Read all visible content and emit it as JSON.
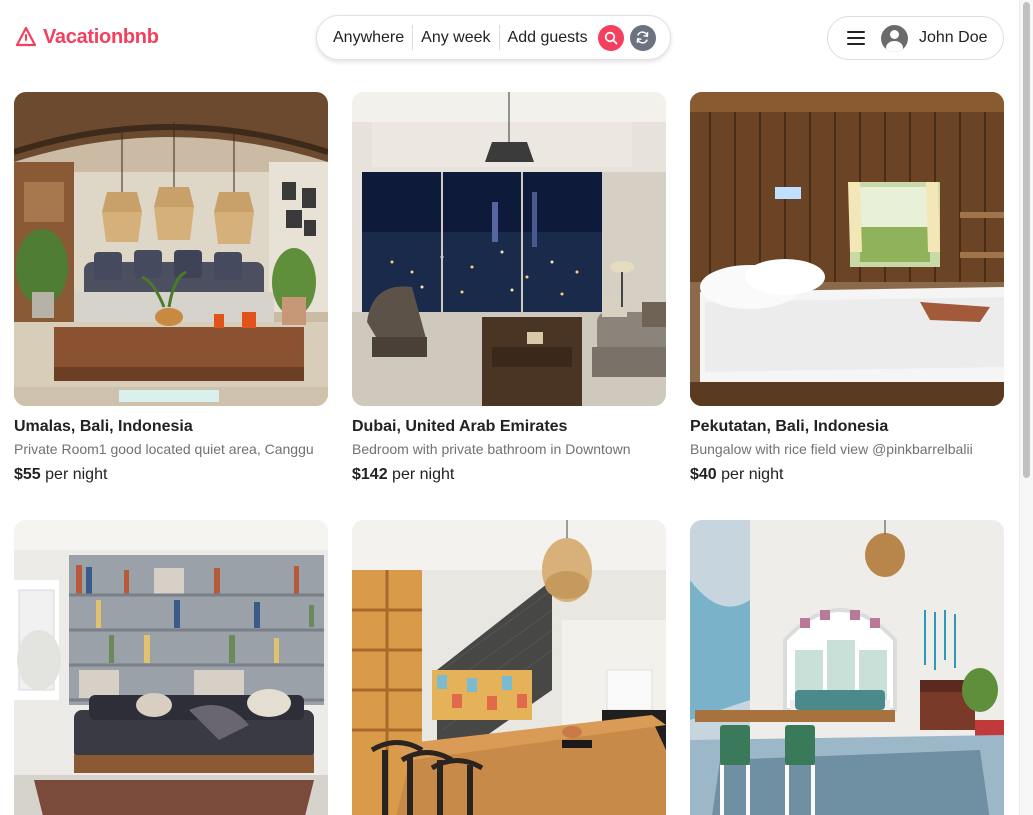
{
  "header": {
    "brand": "Vacationbnb",
    "search": {
      "where": "Anywhere",
      "when": "Any week",
      "who": "Add guests"
    },
    "user": {
      "name": "John Doe"
    }
  },
  "listings": [
    {
      "location": "Umalas, Bali, Indonesia",
      "description": "Private Room1 good located quiet area, Canggu",
      "price": "$55",
      "price_unit": "per night"
    },
    {
      "location": "Dubai, United Arab Emirates",
      "description": "Bedroom with private bathroom in Downtown",
      "price": "$142",
      "price_unit": "per night"
    },
    {
      "location": "Pekutatan, Bali, Indonesia",
      "description": "Bungalow with rice field view @pinkbarrelbalii",
      "price": "$40",
      "price_unit": "per night"
    },
    {
      "location": "",
      "description": "",
      "price": "",
      "price_unit": ""
    },
    {
      "location": "",
      "description": "",
      "price": "",
      "price_unit": ""
    },
    {
      "location": "",
      "description": "",
      "price": "",
      "price_unit": ""
    }
  ],
  "colors": {
    "brand": "#f43f5e",
    "text": "#222222",
    "muted": "#717171",
    "border": "#dddddd"
  }
}
